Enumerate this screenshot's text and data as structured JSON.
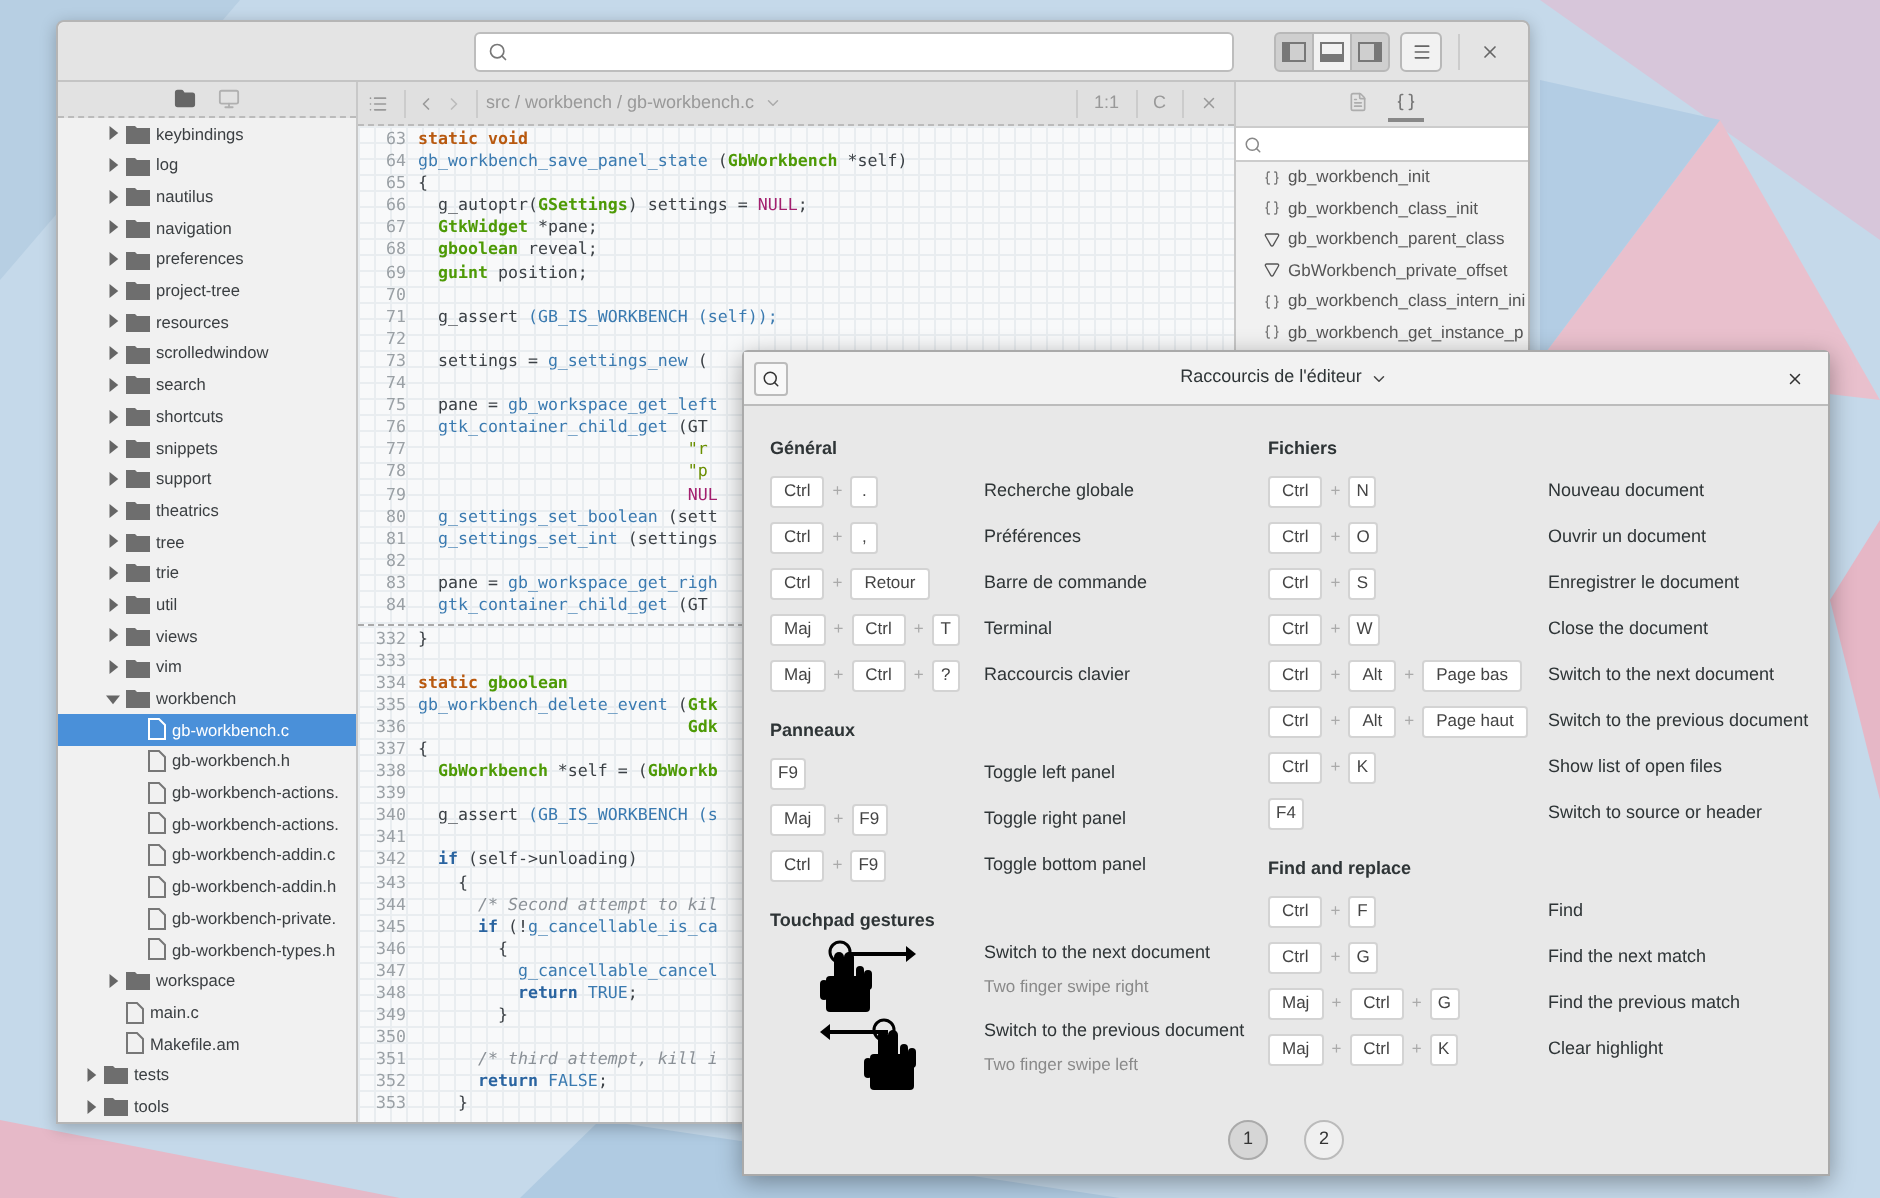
{
  "editor": {
    "layout_buttons": [
      {
        "kind": "left",
        "selected": true
      },
      {
        "kind": "bottom",
        "selected": false
      },
      {
        "kind": "right",
        "selected": true
      }
    ],
    "sidebar": {
      "tabs": [
        {
          "kind": "files",
          "selected": true
        },
        {
          "kind": "terminal",
          "selected": false
        }
      ],
      "tree": [
        {
          "kind": "folder",
          "expanded": true,
          "children": [
            {
              "name": "keybindings",
              "kind": "folder",
              "expanded": false,
              "selected": false
            },
            {
              "name": "log",
              "kind": "folder",
              "expanded": false,
              "selected": false
            },
            {
              "name": "nautilus",
              "kind": "folder",
              "expanded": false,
              "selected": false
            },
            {
              "name": "navigation",
              "kind": "folder",
              "expanded": false,
              "selected": false
            },
            {
              "name": "preferences",
              "kind": "folder",
              "expanded": false,
              "selected": false
            },
            {
              "name": "project-tree",
              "kind": "folder",
              "expanded": false,
              "selected": false
            },
            {
              "name": "resources",
              "kind": "folder",
              "expanded": false,
              "selected": false
            },
            {
              "name": "scrolledwindow",
              "kind": "folder",
              "expanded": false,
              "selected": false
            },
            {
              "name": "search",
              "kind": "folder",
              "expanded": false,
              "selected": false
            },
            {
              "name": "shortcuts",
              "kind": "folder",
              "expanded": false,
              "selected": false
            },
            {
              "name": "snippets",
              "kind": "folder",
              "expanded": false,
              "selected": false
            },
            {
              "name": "support",
              "kind": "folder",
              "expanded": false,
              "selected": false
            },
            {
              "name": "theatrics",
              "kind": "folder",
              "expanded": false,
              "selected": false
            },
            {
              "name": "tree",
              "kind": "folder",
              "expanded": false,
              "selected": false
            },
            {
              "name": "trie",
              "kind": "folder",
              "expanded": false,
              "selected": false
            },
            {
              "name": "util",
              "kind": "folder",
              "expanded": false,
              "selected": false
            },
            {
              "name": "views",
              "kind": "folder",
              "expanded": false,
              "selected": false
            },
            {
              "name": "vim",
              "kind": "folder",
              "expanded": false,
              "selected": false
            },
            {
              "name": "workbench",
              "kind": "folder",
              "expanded": true,
              "selected": false,
              "children": [
                {
                  "name": "gb-workbench.c",
                  "kind": "file",
                  "selected": true
                },
                {
                  "name": "gb-workbench.h",
                  "kind": "file",
                  "selected": false
                },
                {
                  "name": "gb-workbench-actions.",
                  "kind": "file",
                  "selected": false
                },
                {
                  "name": "gb-workbench-actions.",
                  "kind": "file",
                  "selected": false
                },
                {
                  "name": "gb-workbench-addin.c",
                  "kind": "file",
                  "selected": false
                },
                {
                  "name": "gb-workbench-addin.h",
                  "kind": "file",
                  "selected": false
                },
                {
                  "name": "gb-workbench-private.",
                  "kind": "file",
                  "selected": false
                },
                {
                  "name": "gb-workbench-types.h",
                  "kind": "file",
                  "selected": false
                }
              ]
            },
            {
              "name": "workspace",
              "kind": "folder",
              "expanded": false,
              "selected": false
            },
            {
              "name": "main.c",
              "kind": "file",
              "selected": false
            },
            {
              "name": "Makefile.am",
              "kind": "file",
              "selected": false
            }
          ]
        },
        {
          "name": "tests",
          "kind": "folder",
          "expanded": false,
          "selected": false
        },
        {
          "name": "tools",
          "kind": "folder",
          "expanded": false,
          "selected": false
        }
      ]
    },
    "code_header": {
      "path": "src / workbench / gb-workbench.c",
      "position": "1:1",
      "language": "C"
    },
    "code_panes": [
      {
        "lines": [
          {
            "number": "63",
            "tokens": [
              {
                "kind": "keyword",
                "text": "static void"
              }
            ]
          },
          {
            "number": "64",
            "tokens": [
              {
                "kind": "function",
                "text": "gb_workbench_save_panel_state"
              },
              {
                "kind": "plain",
                "text": " ("
              },
              {
                "kind": "type",
                "text": "GbWorkbench"
              },
              {
                "kind": "plain",
                "text": " *self)"
              }
            ]
          },
          {
            "number": "65",
            "tokens": [
              {
                "kind": "plain",
                "text": "{"
              }
            ]
          },
          {
            "number": "66",
            "tokens": [
              {
                "kind": "plain",
                "text": "  g_autoptr("
              },
              {
                "kind": "type",
                "text": "GSettings"
              },
              {
                "kind": "plain",
                "text": ") settings = "
              },
              {
                "kind": "constant",
                "text": "NULL"
              },
              {
                "kind": "plain",
                "text": ";"
              }
            ]
          },
          {
            "number": "67",
            "tokens": [
              {
                "kind": "type",
                "text": "  GtkWidget"
              },
              {
                "kind": "plain",
                "text": " *pane;"
              }
            ]
          },
          {
            "number": "68",
            "tokens": [
              {
                "kind": "type",
                "text": "  gboolean"
              },
              {
                "kind": "plain",
                "text": " reveal;"
              }
            ]
          },
          {
            "number": "69",
            "tokens": [
              {
                "kind": "type",
                "text": "  guint"
              },
              {
                "kind": "plain",
                "text": " position;"
              }
            ]
          },
          {
            "number": "70"
          },
          {
            "number": "71",
            "tokens": [
              {
                "kind": "plain",
                "text": "  g_assert "
              },
              {
                "kind": "function",
                "text": "(GB_IS_WORKBENCH (self));"
              }
            ]
          },
          {
            "number": "72"
          },
          {
            "number": "73",
            "tokens": [
              {
                "kind": "plain",
                "text": "  settings = "
              },
              {
                "kind": "function",
                "text": "g_settings_new"
              },
              {
                "kind": "plain",
                "text": " ("
              }
            ]
          },
          {
            "number": "74"
          },
          {
            "number": "75",
            "tokens": [
              {
                "kind": "plain",
                "text": "  pane = "
              },
              {
                "kind": "function",
                "text": "gb_workspace_get_left"
              }
            ]
          },
          {
            "number": "76",
            "tokens": [
              {
                "kind": "function",
                "text": "  gtk_container_child_get"
              },
              {
                "kind": "plain",
                "text": " (GT"
              }
            ]
          },
          {
            "number": "77",
            "tokens": [
              {
                "kind": "string",
                "text": "                           \"r"
              }
            ]
          },
          {
            "number": "78",
            "tokens": [
              {
                "kind": "string",
                "text": "                           \"p"
              }
            ]
          },
          {
            "number": "79",
            "tokens": [
              {
                "kind": "constant",
                "text": "                           NUL"
              }
            ]
          },
          {
            "number": "80",
            "tokens": [
              {
                "kind": "function",
                "text": "  g_settings_set_boolean"
              },
              {
                "kind": "plain",
                "text": " (sett"
              }
            ]
          },
          {
            "number": "81",
            "tokens": [
              {
                "kind": "function",
                "text": "  g_settings_set_int"
              },
              {
                "kind": "plain",
                "text": " (settings"
              }
            ]
          },
          {
            "number": "82"
          },
          {
            "number": "83",
            "tokens": [
              {
                "kind": "plain",
                "text": "  pane = "
              },
              {
                "kind": "function",
                "text": "gb_workspace_get_righ"
              }
            ]
          },
          {
            "number": "84",
            "tokens": [
              {
                "kind": "function",
                "text": "  gtk_container_child_get"
              },
              {
                "kind": "plain",
                "text": " (GT"
              }
            ]
          }
        ]
      },
      {
        "lines": [
          {
            "number": "332",
            "tokens": [
              {
                "kind": "plain",
                "text": "}"
              }
            ]
          },
          {
            "number": "333"
          },
          {
            "number": "334",
            "tokens": [
              {
                "kind": "keyword",
                "text": "static "
              },
              {
                "kind": "type",
                "text": "gboolean"
              }
            ]
          },
          {
            "number": "335",
            "tokens": [
              {
                "kind": "function",
                "text": "gb_workbench_delete_event"
              },
              {
                "kind": "plain",
                "text": " ("
              },
              {
                "kind": "type",
                "text": "Gtk"
              }
            ]
          },
          {
            "number": "336",
            "tokens": [
              {
                "kind": "type",
                "text": "                           Gdk"
              }
            ]
          },
          {
            "number": "337",
            "tokens": [
              {
                "kind": "plain",
                "text": "{"
              }
            ]
          },
          {
            "number": "338",
            "tokens": [
              {
                "kind": "type",
                "text": "  GbWorkbench"
              },
              {
                "kind": "plain",
                "text": " *self = ("
              },
              {
                "kind": "type",
                "text": "GbWorkb"
              }
            ]
          },
          {
            "number": "339"
          },
          {
            "number": "340",
            "tokens": [
              {
                "kind": "plain",
                "text": "  g_assert "
              },
              {
                "kind": "function",
                "text": "(GB_IS_WORKBENCH (s"
              }
            ]
          },
          {
            "number": "341"
          },
          {
            "number": "342",
            "tokens": [
              {
                "kind": "statement",
                "text": "  if"
              },
              {
                "kind": "plain",
                "text": " (self->unloading)"
              }
            ]
          },
          {
            "number": "343",
            "tokens": [
              {
                "kind": "plain",
                "text": "    {"
              }
            ]
          },
          {
            "number": "344",
            "tokens": [
              {
                "kind": "comment",
                "text": "      /* Second attempt to kil"
              }
            ]
          },
          {
            "number": "345",
            "tokens": [
              {
                "kind": "statement",
                "text": "      if"
              },
              {
                "kind": "plain",
                "text": " (!"
              },
              {
                "kind": "function",
                "text": "g_cancellable_is_ca"
              }
            ]
          },
          {
            "number": "346",
            "tokens": [
              {
                "kind": "plain",
                "text": "        {"
              }
            ]
          },
          {
            "number": "347",
            "tokens": [
              {
                "kind": "function",
                "text": "          g_cancellable_cancel"
              }
            ]
          },
          {
            "number": "348",
            "tokens": [
              {
                "kind": "statement",
                "text": "          return"
              },
              {
                "kind": "function",
                "text": " TRUE"
              },
              {
                "kind": "plain",
                "text": ";"
              }
            ]
          },
          {
            "number": "349",
            "tokens": [
              {
                "kind": "plain",
                "text": "        }"
              }
            ]
          },
          {
            "number": "350"
          },
          {
            "number": "351",
            "tokens": [
              {
                "kind": "comment",
                "text": "      /* third attempt, kill i"
              }
            ]
          },
          {
            "number": "352",
            "tokens": [
              {
                "kind": "statement",
                "text": "      return"
              },
              {
                "kind": "function",
                "text": " FALSE"
              },
              {
                "kind": "plain",
                "text": ";"
              }
            ]
          },
          {
            "number": "353",
            "tokens": [
              {
                "kind": "plain",
                "text": "    }"
              }
            ]
          }
        ]
      }
    ],
    "symbols": {
      "tabs": [
        {
          "kind": "document",
          "selected": false
        },
        {
          "kind": "symbols",
          "selected": true
        }
      ],
      "items": [
        {
          "kind": "function",
          "name": "gb_workbench_init",
          "selected": false
        },
        {
          "kind": "function",
          "name": "gb_workbench_class_init",
          "selected": false
        },
        {
          "kind": "variable",
          "name": "gb_workbench_parent_class",
          "selected": false
        },
        {
          "kind": "variable",
          "name": "GbWorkbench_private_offset",
          "selected": false
        },
        {
          "kind": "function",
          "name": "gb_workbench_class_intern_ini",
          "selected": false
        },
        {
          "kind": "function",
          "name": "gb_workbench_get_instance_p",
          "selected": false
        }
      ]
    }
  },
  "dialog": {
    "title": "Raccourcis de l'éditeur",
    "columns": [
      {
        "sections": [
          {
            "title": "Général",
            "rows": [
              {
                "kind": "keys",
                "keys": [
                  "Ctrl",
                  "+",
                  "."
                ],
                "description": "Recherche globale"
              },
              {
                "kind": "keys",
                "keys": [
                  "Ctrl",
                  "+",
                  ","
                ],
                "description": "Préférences"
              },
              {
                "kind": "keys",
                "keys": [
                  "Ctrl",
                  "+",
                  "Retour"
                ],
                "description": "Barre de commande"
              },
              {
                "kind": "keys",
                "keys": [
                  "Maj",
                  "+",
                  "Ctrl",
                  "+",
                  "T"
                ],
                "description": "Terminal"
              },
              {
                "kind": "keys",
                "keys": [
                  "Maj",
                  "+",
                  "Ctrl",
                  "+",
                  "?"
                ],
                "description": "Raccourcis clavier"
              }
            ]
          },
          {
            "title": "Panneaux",
            "rows": [
              {
                "kind": "keys",
                "keys": [
                  "F9"
                ],
                "description": "Toggle left panel"
              },
              {
                "kind": "keys",
                "keys": [
                  "Maj",
                  "+",
                  "F9"
                ],
                "description": "Toggle right panel"
              },
              {
                "kind": "keys",
                "keys": [
                  "Ctrl",
                  "+",
                  "F9"
                ],
                "description": "Toggle bottom panel"
              }
            ]
          },
          {
            "title": "Touchpad gestures",
            "rows": [
              {
                "kind": "swipe_right",
                "description": "Switch to the next document",
                "hint": "Two finger swipe right"
              },
              {
                "kind": "swipe_left",
                "description": "Switch to the previous document",
                "hint": "Two finger swipe left"
              }
            ]
          }
        ]
      },
      {
        "sections": [
          {
            "title": "Fichiers",
            "rows": [
              {
                "kind": "keys",
                "keys": [
                  "Ctrl",
                  "+",
                  "N"
                ],
                "description": "Nouveau document"
              },
              {
                "kind": "keys",
                "keys": [
                  "Ctrl",
                  "+",
                  "O"
                ],
                "description": "Ouvrir un document"
              },
              {
                "kind": "keys",
                "keys": [
                  "Ctrl",
                  "+",
                  "S"
                ],
                "description": "Enregistrer le document"
              },
              {
                "kind": "keys",
                "keys": [
                  "Ctrl",
                  "+",
                  "W"
                ],
                "description": "Close the document"
              },
              {
                "kind": "keys",
                "keys": [
                  "Ctrl",
                  "+",
                  "Alt",
                  "+",
                  "Page bas"
                ],
                "description": "Switch to the next document"
              },
              {
                "kind": "keys",
                "keys": [
                  "Ctrl",
                  "+",
                  "Alt",
                  "+",
                  "Page haut"
                ],
                "description": "Switch to the previous document"
              },
              {
                "kind": "keys",
                "keys": [
                  "Ctrl",
                  "+",
                  "K"
                ],
                "description": "Show list of open files"
              },
              {
                "kind": "keys",
                "keys": [
                  "F4"
                ],
                "description": "Switch to source or header"
              }
            ]
          },
          {
            "title": "Find and replace",
            "rows": [
              {
                "kind": "keys",
                "keys": [
                  "Ctrl",
                  "+",
                  "F"
                ],
                "description": "Find"
              },
              {
                "kind": "keys",
                "keys": [
                  "Ctrl",
                  "+",
                  "G"
                ],
                "description": "Find the next match"
              },
              {
                "kind": "keys",
                "keys": [
                  "Maj",
                  "+",
                  "Ctrl",
                  "+",
                  "G"
                ],
                "description": "Find the previous match"
              },
              {
                "kind": "keys",
                "keys": [
                  "Maj",
                  "+",
                  "Ctrl",
                  "+",
                  "K"
                ],
                "description": "Clear highlight"
              }
            ]
          }
        ]
      }
    ],
    "pages": [
      {
        "label": "1",
        "selected": true
      },
      {
        "label": "2",
        "selected": false
      }
    ]
  }
}
